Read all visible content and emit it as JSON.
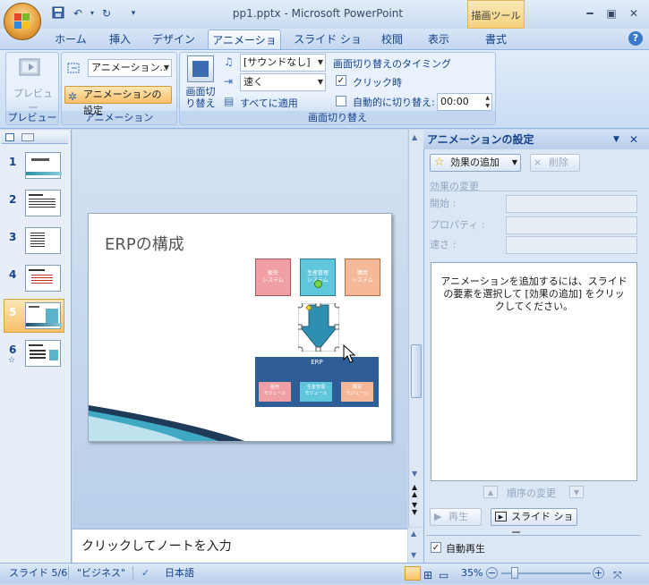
{
  "window": {
    "title": "pp1.pptx - Microsoft PowerPoint",
    "contextual_tab": "描画ツール"
  },
  "tabs": [
    "ホーム",
    "挿入",
    "デザイン",
    "アニメーション",
    "スライド ショー",
    "校閲",
    "表示",
    "書式"
  ],
  "ribbon": {
    "preview_group": {
      "label": "プレビュー",
      "button": "プレビュー"
    },
    "animation_group": {
      "label": "アニメーション",
      "combo_value": "アニメーション..",
      "custom_btn": "アニメーションの設定"
    },
    "transition_group": {
      "label": "画面切り替え",
      "big_btn_line1": "画面切",
      "big_btn_line2": "り替え",
      "sound": "[サウンドなし]",
      "speed": "速く",
      "apply_all": "すべてに適用"
    },
    "timing_group": {
      "title": "画面切り替えのタイミング",
      "on_click": "クリック時",
      "auto_label": "自動的に切り替え:",
      "auto_value": "00:00"
    }
  },
  "slides": {
    "numbers": [
      "1",
      "2",
      "3",
      "4",
      "5",
      "6"
    ],
    "selected": "5"
  },
  "slide": {
    "title": "ERPの構成",
    "box1": "販売\nシステム",
    "box2": "生産管理\nシステム",
    "box3": "購買\nシステム",
    "erp": "ERP",
    "mod1": "販売\nモジュール",
    "mod2": "生産管理\nモジュール",
    "mod3": "購買\nモジュール"
  },
  "notes_placeholder": "クリックしてノートを入力",
  "taskpane": {
    "title": "アニメーションの設定",
    "add_effect": "効果の追加",
    "remove": "削除",
    "change_effect": "効果の変更",
    "start_label": "開始 :",
    "property_label": "プロパティ :",
    "speed_label": "速さ :",
    "info": "アニメーションを追加するには、スライドの要素を選択して [効果の追加] をクリックしてください。",
    "reorder": "順序の変更",
    "play": "再生",
    "slideshow": "スライド ショー",
    "autoplay": "自動再生"
  },
  "status": {
    "slide": "スライド 5/6",
    "theme": "\"ビジネス\"",
    "language": "日本語",
    "zoom": "35%"
  }
}
